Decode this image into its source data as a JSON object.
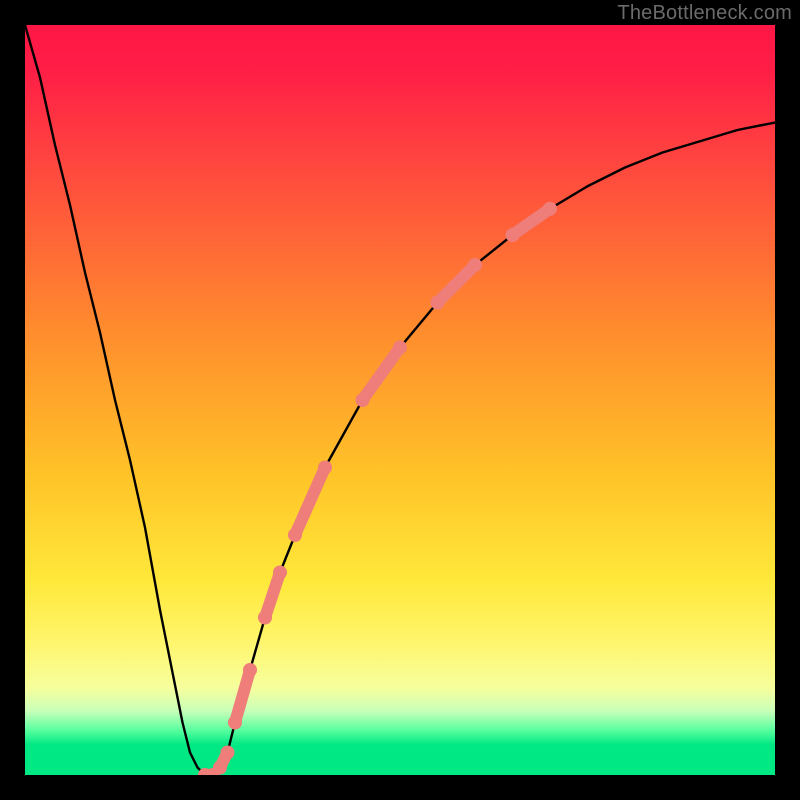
{
  "watermark": "TheBottleneck.com",
  "chart_data": {
    "type": "line",
    "title": "",
    "xlabel": "",
    "ylabel": "",
    "xlim": [
      0,
      100
    ],
    "ylim": [
      0,
      100
    ],
    "grid": false,
    "legend": false,
    "curve_note": "V-shaped bottleneck curve; y≈0 is optimal (green), y≈100 is worst (red). Minimum near x≈24.",
    "x": [
      0,
      2,
      4,
      6,
      8,
      10,
      12,
      14,
      16,
      18,
      19,
      20,
      21,
      22,
      23,
      24,
      25,
      26,
      27,
      28,
      30,
      32,
      34,
      36,
      40,
      45,
      50,
      55,
      60,
      65,
      70,
      75,
      80,
      85,
      90,
      95,
      100
    ],
    "values": [
      100,
      93,
      84,
      76,
      67,
      59,
      50,
      42,
      33,
      22,
      17,
      12,
      7,
      3,
      1,
      0,
      0,
      1,
      3,
      7,
      14,
      21,
      27,
      32,
      41,
      50,
      57,
      63,
      68,
      72,
      75.5,
      78.5,
      81,
      83,
      84.5,
      86,
      87
    ],
    "markers": {
      "note": "Salmon dotted segments overlaid near curve bottom on both arms",
      "color": "#ef7d7a",
      "points_by_index_into_x": [
        15,
        16,
        17,
        18,
        19,
        20,
        21,
        22,
        23,
        24,
        25,
        26,
        27,
        28,
        29,
        30
      ]
    },
    "background_gradient_stops": [
      {
        "pos": 0.0,
        "color": "#ff1646"
      },
      {
        "pos": 0.2,
        "color": "#ff4b3e"
      },
      {
        "pos": 0.4,
        "color": "#ff8a2e"
      },
      {
        "pos": 0.6,
        "color": "#ffc328"
      },
      {
        "pos": 0.82,
        "color": "#fff56a"
      },
      {
        "pos": 0.915,
        "color": "#c7ffb9"
      },
      {
        "pos": 0.96,
        "color": "#00e884"
      },
      {
        "pos": 1.0,
        "color": "#00e884"
      }
    ]
  }
}
